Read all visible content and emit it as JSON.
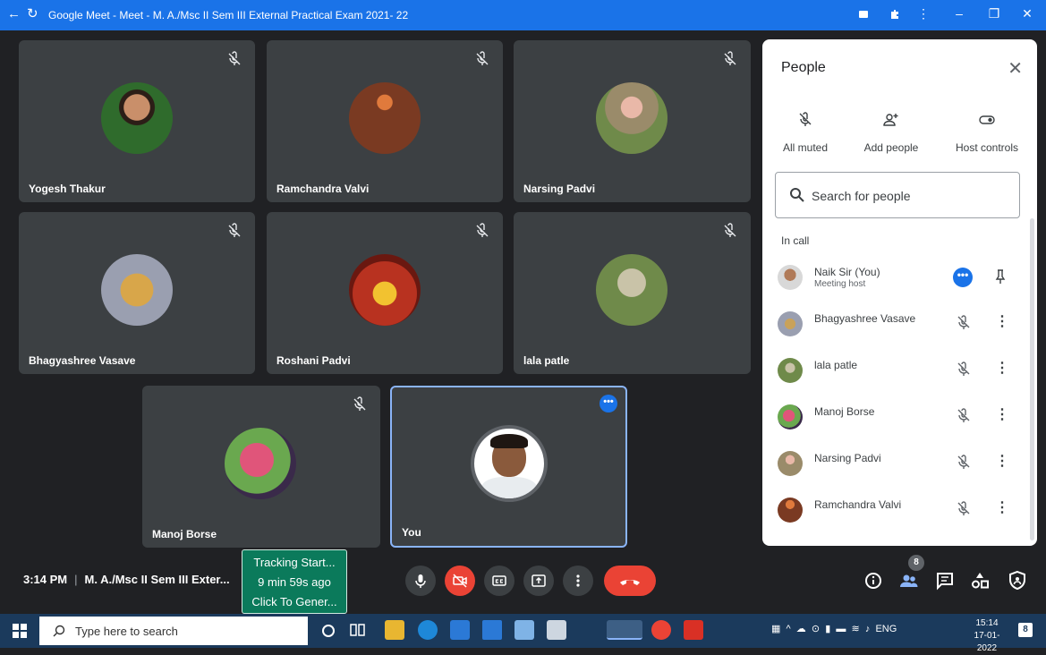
{
  "window": {
    "title": "Google Meet - Meet - M. A./Msc II Sem III External Practical Exam 2021- 22",
    "back_glyph": "←",
    "reload_glyph": "↻",
    "controls": [
      "–",
      "❐",
      "✕"
    ]
  },
  "tiles": [
    {
      "name": "Yogesh Thakur",
      "muted": true
    },
    {
      "name": "Ramchandra Valvi",
      "muted": true
    },
    {
      "name": "Narsing Padvi",
      "muted": true
    },
    {
      "name": "Bhagyashree Vasave",
      "muted": true
    },
    {
      "name": "Roshani Padvi",
      "muted": true
    },
    {
      "name": "lala patle",
      "muted": true
    },
    {
      "name": "Manoj Borse",
      "muted": true
    },
    {
      "name": "You",
      "muted": false
    }
  ],
  "you_more_glyph": "•••",
  "people_panel": {
    "title": "People",
    "close_glyph": "✕",
    "host_controls": [
      {
        "label": "All muted",
        "icon": "mic-off-icon"
      },
      {
        "label": "Add people",
        "icon": "add-person-icon"
      },
      {
        "label": "Host controls",
        "icon": "toggle-icon"
      }
    ],
    "search_placeholder": "Search for people",
    "section_label": "In call",
    "participants": [
      {
        "name": "Naik Sir (You)",
        "subtitle": "Meeting host",
        "is_host": true
      },
      {
        "name": "Bhagyashree Vasave",
        "subtitle": "",
        "is_host": false
      },
      {
        "name": "lala patle",
        "subtitle": "",
        "is_host": false
      },
      {
        "name": "Manoj Borse",
        "subtitle": "",
        "is_host": false
      },
      {
        "name": "Narsing Padvi",
        "subtitle": "",
        "is_host": false
      },
      {
        "name": "Ramchandra Valvi",
        "subtitle": "",
        "is_host": false
      }
    ],
    "host_more_glyph": "•••",
    "more_glyph": "⋮"
  },
  "bottom_bar": {
    "time": "3:14 PM",
    "separator": "|",
    "meeting_title": "M. A./Msc II Sem III Exter...",
    "people_count": "8"
  },
  "tracking_popup": {
    "line1": "Tracking Start...",
    "line2": "9 min 59s ago",
    "line3": "Click To Gener..."
  },
  "taskbar": {
    "search_placeholder": "Type here to search",
    "language": "ENG",
    "time": "15:14",
    "date": "17-01-2022",
    "notification_count": "8"
  },
  "colors": {
    "brand_blue": "#1a73e8",
    "end_call_red": "#ea4335",
    "tile_bg": "#3c4043",
    "meet_bg": "#202124",
    "tracking_green": "#0b7a5b"
  }
}
